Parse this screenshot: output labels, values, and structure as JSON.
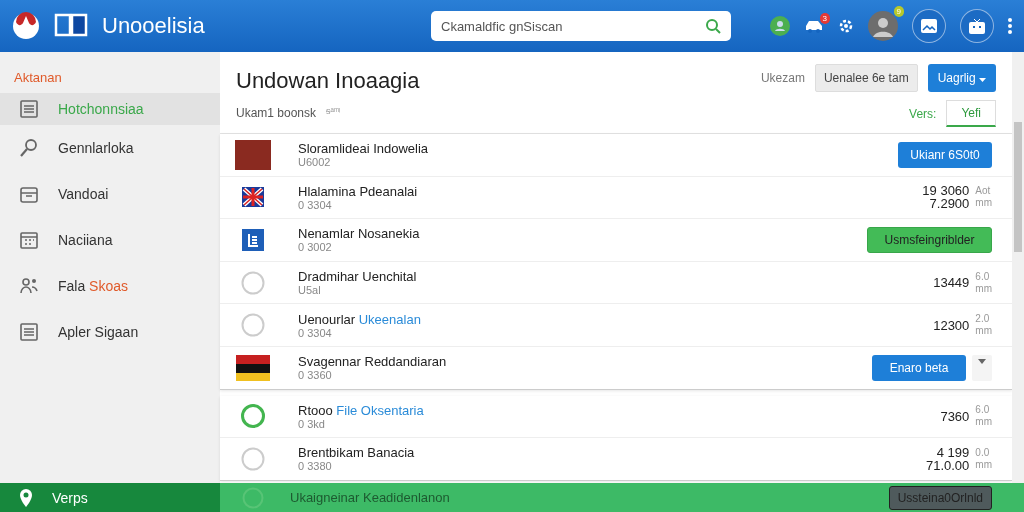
{
  "header": {
    "app_name": "Unooelisia",
    "search": {
      "placeholder": "Ckamaldfic gnSiscan"
    },
    "notification_badge": "3",
    "avatar_badge": "9"
  },
  "sidebar": {
    "heading": "Aktanan",
    "items": [
      {
        "label": "Hotchonnsiaa",
        "kind": "list",
        "selected": true
      },
      {
        "label": "Gennlarloka",
        "kind": "search",
        "selected": false
      },
      {
        "label": "Vandoai",
        "kind": "inbox",
        "selected": false
      },
      {
        "label": "Naciiana",
        "kind": "calendar",
        "selected": false
      },
      {
        "label": "Fala",
        "accent": "Skoas",
        "kind": "people",
        "selected": false
      },
      {
        "label": "Apler Sigaan",
        "kind": "list",
        "selected": false
      }
    ]
  },
  "main": {
    "title": "Undowan Inoaagia",
    "subtitle": "Ukam1 boonsk",
    "subtitle_extra": "ᵴᵃᵐᵎ",
    "sort_label": "Ukezam",
    "filter_button": "Uenalee 6e tam",
    "menu_button": "Uagrlig",
    "view_label": "Vers:",
    "view_tab": "Yefi"
  },
  "sections": [
    [
      {
        "kind": "photo",
        "title": "Sloramlideai Indowelia",
        "sub": "U6002",
        "action": {
          "kind": "blue",
          "label": "Ukianr 6S0t0"
        }
      },
      {
        "kind": "flag-cross",
        "title": "Hlalamina Pdeanalai",
        "sub": "0 3304",
        "values": [
          "19 3060",
          "7.2900"
        ],
        "units": [
          "Aot",
          "mm"
        ]
      },
      {
        "kind": "logo",
        "title": "Nenamlar Nosanekia",
        "sub": "0 3002",
        "action": {
          "kind": "green",
          "label": "Usmsfeingriblder"
        }
      },
      {
        "kind": "circle",
        "selected": false,
        "title": "Dradmihar Uenchital",
        "sub": "U5al",
        "values": [
          "13449"
        ],
        "units": [
          "6.0",
          "mm"
        ]
      },
      {
        "kind": "circle",
        "selected": false,
        "title": "Uenourlar",
        "accent": "Ukeenalan",
        "sub": "0 3304",
        "values": [
          "12300"
        ],
        "units": [
          "2.0",
          "mm"
        ]
      },
      {
        "kind": "flag-stripes",
        "title": "Svagennar Reddandiaran",
        "sub": "0 3360",
        "action": {
          "kind": "blue",
          "label": "Enaro beta",
          "caret": true
        }
      }
    ],
    [
      {
        "kind": "circle",
        "selected": true,
        "title": "Rtooo",
        "accent": "File Oksentaria",
        "sub": "0 3kd",
        "values": [
          "7360"
        ],
        "units": [
          "6.0",
          "mm"
        ]
      },
      {
        "kind": "circle",
        "selected": false,
        "title": "Brentbikam Banacia",
        "sub": "0 3380",
        "values": [
          "4 199",
          "71.0.00"
        ],
        "units": [
          "0.0",
          "mm"
        ]
      }
    ]
  ],
  "footer": {
    "label": "Verps",
    "row_title": "Ukaigneinar Keadidenlanon",
    "button": "Ussteina0Orlnld"
  }
}
